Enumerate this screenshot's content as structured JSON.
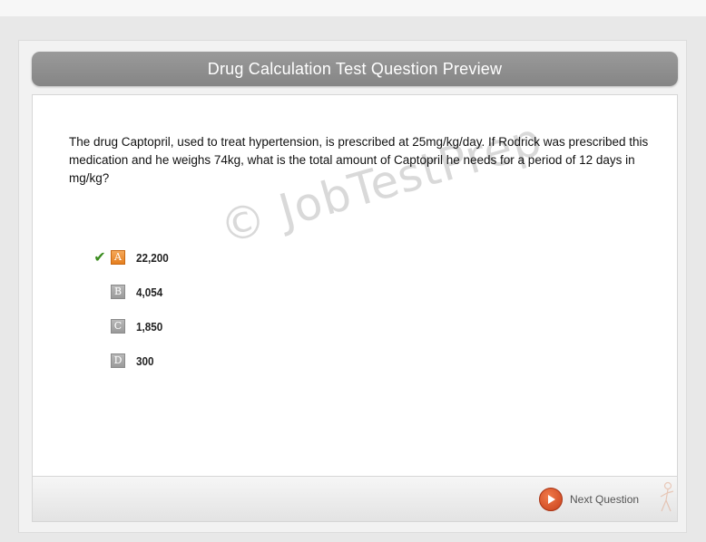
{
  "title": "Drug Calculation Test Question Preview",
  "question": "The drug Captopril, used to treat hypertension, is prescribed at 25mg/kg/day. If Rodrick was prescribed this medication and he weighs 74kg, what is the total amount of Captopril he needs for a period of 12 days in mg/kg?",
  "watermark": "© JobTestPrep",
  "answers": [
    {
      "letter": "A",
      "value": "22,200",
      "correct": true
    },
    {
      "letter": "B",
      "value": "4,054",
      "correct": false
    },
    {
      "letter": "C",
      "value": "1,850",
      "correct": false
    },
    {
      "letter": "D",
      "value": "300",
      "correct": false
    }
  ],
  "check_symbol": "✔",
  "next_button": {
    "label": "Next Question",
    "icon": "play-icon"
  },
  "colors": {
    "title_bar": "#8f8f8f",
    "correct_letter": "#e57f1f",
    "check": "#3a8c1e",
    "next_icon": "#c8401b"
  }
}
